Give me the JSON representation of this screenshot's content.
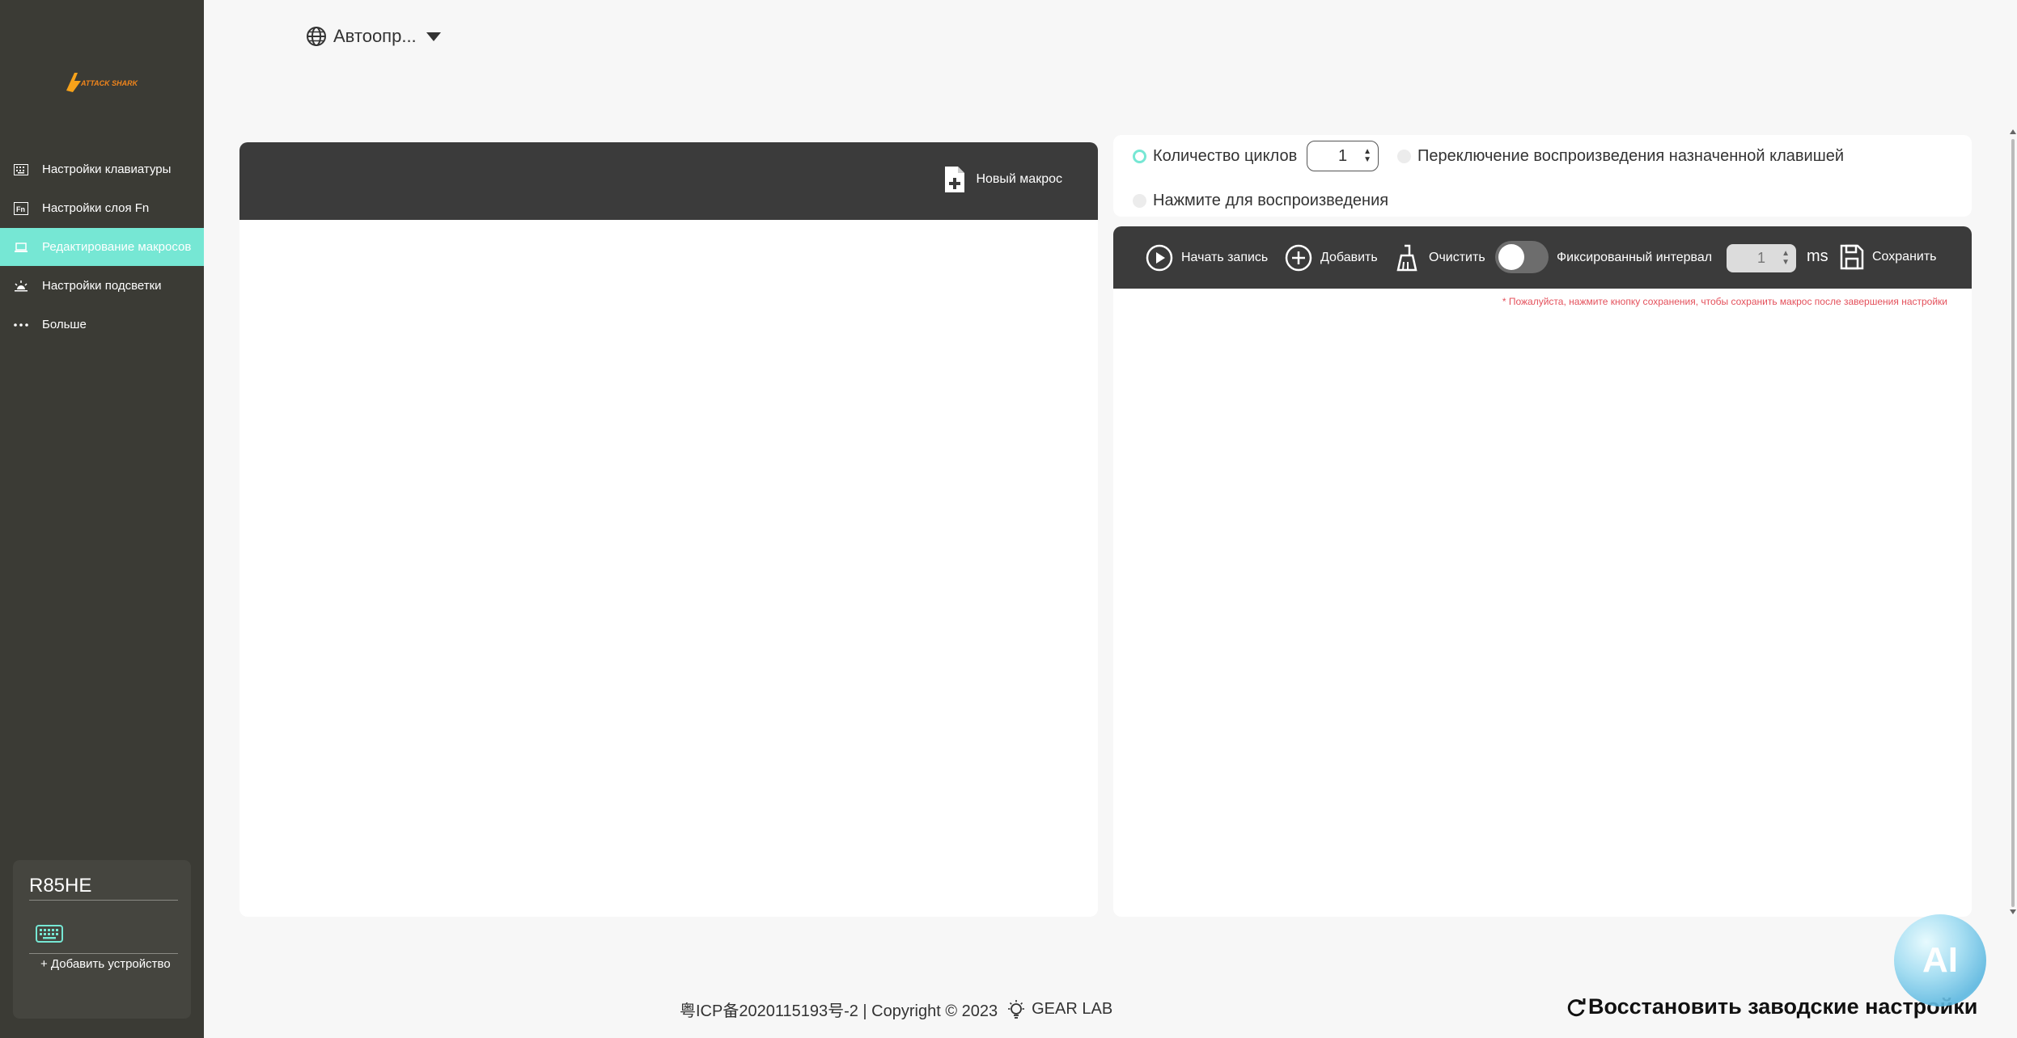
{
  "app": {
    "logo_text": "ATTACK SHARK"
  },
  "sidebar": {
    "items": [
      {
        "label": "Настройки клавиатуры",
        "icon": "keyboard-grid-icon",
        "active": false
      },
      {
        "label": "Настройки слоя Fn",
        "icon": "fn-key-icon",
        "active": false
      },
      {
        "label": "Редактирование макросов",
        "icon": "laptop-icon",
        "active": true
      },
      {
        "label": "Настройки подсветки",
        "icon": "sun-icon",
        "active": false
      },
      {
        "label": "Больше",
        "icon": "more-dots-icon",
        "active": false
      }
    ],
    "device": {
      "name": "R85HE",
      "icon": "keyboard-icon",
      "add_label": "+ Добавить устройство"
    }
  },
  "header": {
    "language_label": "Автоопр..."
  },
  "macro_list": {
    "new_macro_label": "Новый макрос"
  },
  "playback": {
    "loop_count_label": "Количество циклов",
    "loop_count_value": "1",
    "toggle_key_label": "Переключение воспроизведения назначенной клавишей",
    "press_play_label": "Нажмите для воспроизведения"
  },
  "editor": {
    "record_label": "Начать запись",
    "add_label": "Добавить",
    "clear_label": "Очистить",
    "fixed_interval_label": "Фиксированный интервал",
    "interval_value": "1",
    "interval_unit": "ms",
    "save_label": "Сохранить",
    "hint": "* Пожалуйста, нажмите кнопку сохранения, чтобы сохранить макрос после завершения настройки"
  },
  "footer": {
    "icp": "粤ICP备2020115193号-2 | Copyright © 2023",
    "brand": "GEAR LAB",
    "restore_label": "Восстановить заводские настройки"
  },
  "ai_assistant": {
    "label": "AI"
  },
  "colors": {
    "sidebar_bg": "#3b3b35",
    "accent": "#76e7d4",
    "toolbar_bg": "#3b3b3b",
    "hint": "#e4505b"
  }
}
